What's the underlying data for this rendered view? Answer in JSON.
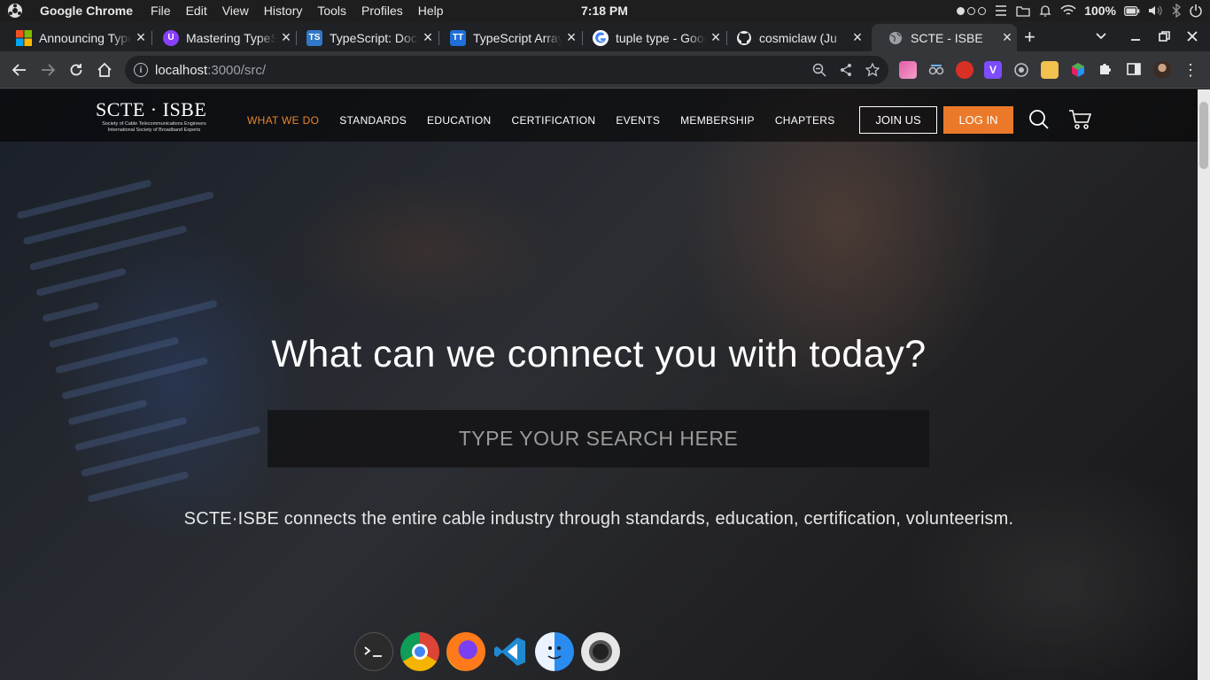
{
  "menubar": {
    "app_name": "Google Chrome",
    "menus": [
      "File",
      "Edit",
      "View",
      "History",
      "Tools",
      "Profiles",
      "Help"
    ],
    "clock": "7:18 PM",
    "battery": "100%"
  },
  "tabs": [
    {
      "title": "Announcing TypeScript",
      "icon": "microsoft-icon",
      "active": false
    },
    {
      "title": "Mastering TypeScript",
      "icon": "purple-u-icon",
      "active": false
    },
    {
      "title": "TypeScript: Documentation",
      "icon": "ts-icon",
      "active": false
    },
    {
      "title": "TypeScript Arrays",
      "icon": "tt-icon",
      "active": false
    },
    {
      "title": "tuple type - Google",
      "icon": "google-icon",
      "active": false
    },
    {
      "title": "cosmiclaw (Ju",
      "icon": "github-icon",
      "active": false
    },
    {
      "title": "SCTE - ISBE",
      "icon": "globe-icon",
      "active": true
    }
  ],
  "toolbar": {
    "url_host": "localhost",
    "url_path": ":3000/src/"
  },
  "site": {
    "logo_main": "SCTE · ISBE",
    "logo_line1": "Society of Cable Telecommunications Engineers",
    "logo_line2": "International Society of Broadband Experts",
    "nav": [
      "WHAT WE DO",
      "STANDARDS",
      "EDUCATION",
      "CERTIFICATION",
      "EVENTS",
      "MEMBERSHIP",
      "CHAPTERS"
    ],
    "join_label": "JOIN US",
    "login_label": "LOG IN",
    "hero_title": "What can we connect you with today?",
    "search_placeholder": "TYPE YOUR SEARCH HERE",
    "tagline": "SCTE·ISBE connects the entire cable industry through standards, education, certification, volunteerism."
  },
  "colors": {
    "accent_orange": "#ea7a2a",
    "active_nav": "#e8842c"
  },
  "dock": [
    "terminal-icon",
    "chrome-icon",
    "firefox-icon",
    "vscode-icon",
    "finder-icon",
    "camera-icon"
  ]
}
